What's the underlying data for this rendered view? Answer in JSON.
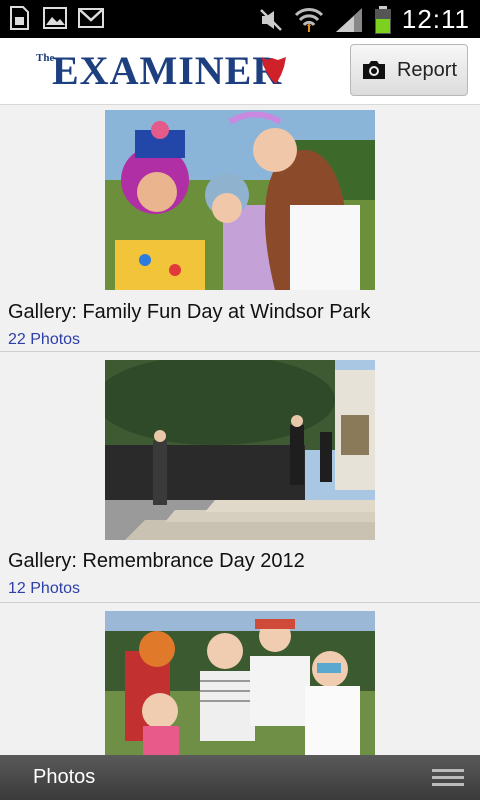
{
  "statusbar": {
    "time": "12:11",
    "left_icons": [
      "sd-card-icon",
      "image-icon",
      "gmail-icon"
    ],
    "right_icons": [
      "mute-icon",
      "wifi-icon",
      "signal-icon",
      "battery-icon"
    ]
  },
  "header": {
    "logo_the": "The",
    "logo_main": "EXAMINER",
    "report_label": "Report"
  },
  "galleries": [
    {
      "title": "Gallery: Family Fun Day at Windsor Park",
      "count": "22 Photos"
    },
    {
      "title": "Gallery: Remembrance Day 2012",
      "count": "12 Photos"
    },
    {
      "title": "",
      "count": ""
    }
  ],
  "bottombar": {
    "title": "Photos"
  },
  "colors": {
    "brand_blue": "#1d3f7f",
    "accent_red": "#d0202a",
    "link_blue": "#2d3fa8"
  }
}
